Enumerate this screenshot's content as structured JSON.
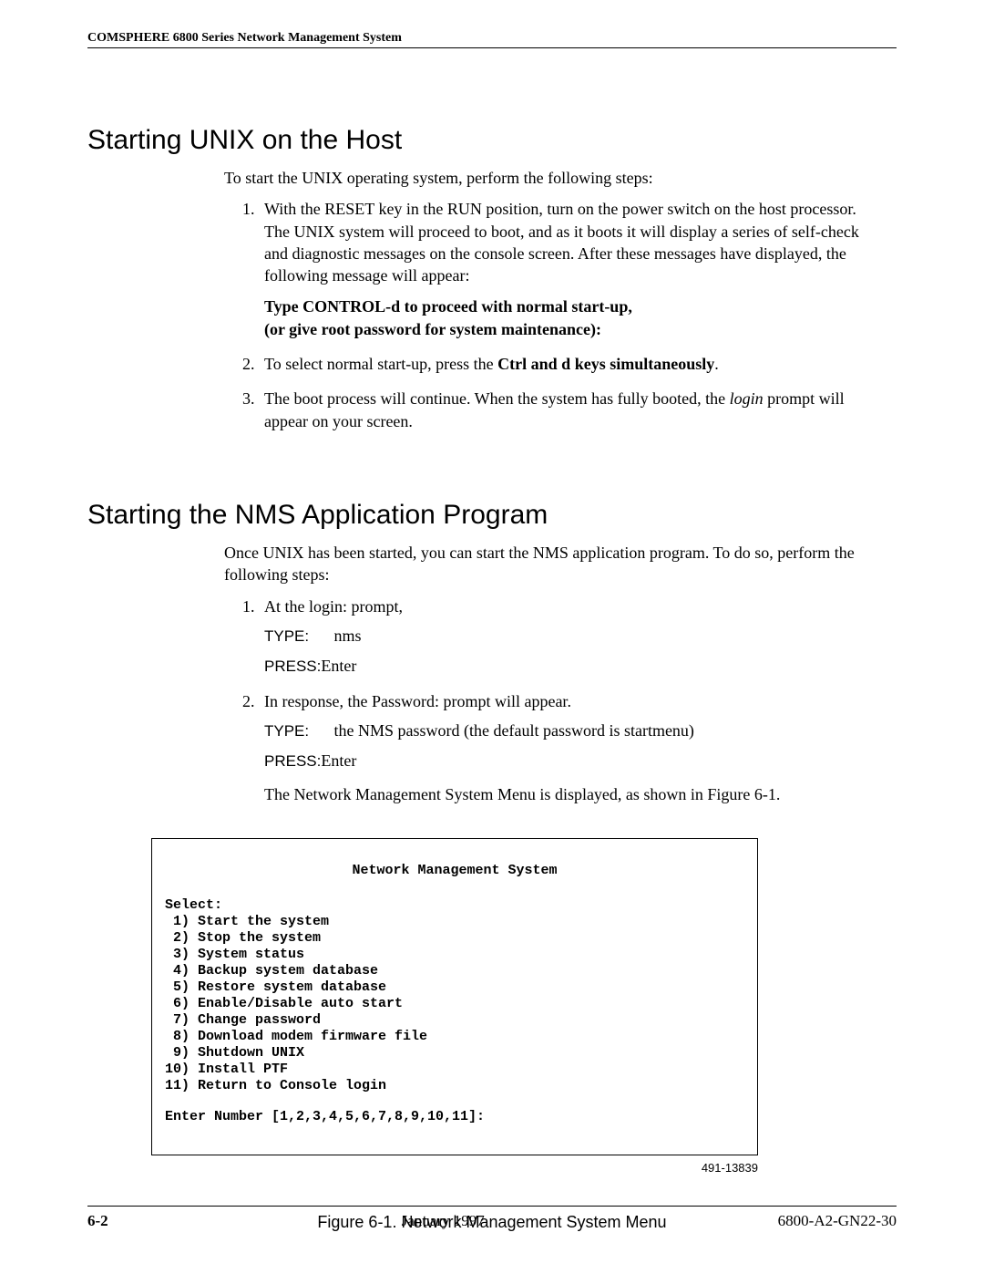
{
  "header": {
    "running_title": "COMSPHERE 6800 Series Network Management System"
  },
  "section1": {
    "heading": "Starting UNIX on the Host",
    "intro": "To start the UNIX operating system, perform the following steps:",
    "step1_text": "With the RESET key in the RUN position, turn on the power switch on the host processor. The UNIX system will proceed to boot, and as it boots it will display a series of self-check and diagnostic messages on the console screen. After these messages have displayed, the following message will appear:",
    "step1_msg_l1": "Type CONTROL-d to proceed with normal start-up,",
    "step1_msg_l2": "(or give root password for system maintenance):",
    "step2_pre": "To select normal start-up, press the ",
    "step2_bold": "Ctrl and d keys simultaneously",
    "step2_post": ".",
    "step3_pre": "The boot process will continue. When the system has fully booted, the ",
    "step3_ital": "login",
    "step3_post": " prompt will appear on your screen."
  },
  "section2": {
    "heading": "Starting the NMS Application Program",
    "intro": "Once UNIX has been started, you can start the NMS application program. To do so, perform the following steps:",
    "step1_text": "At the login: prompt,",
    "type_label": "TYPE:",
    "press_label": "PRESS:",
    "nms": "nms",
    "enter": "Enter",
    "step2_text": "In response, the Password: prompt will appear.",
    "step2_type_val": "the NMS password (the default password is startmenu)",
    "step2_result": "The Network Management System Menu is displayed, as shown in Figure 6-1."
  },
  "figure": {
    "title": "Network Management System",
    "select": "Select:",
    "items": [
      " 1) Start the system",
      " 2) Stop the system",
      " 3) System status",
      " 4) Backup system database",
      " 5) Restore system database",
      " 6) Enable/Disable auto start",
      " 7) Change password",
      " 8) Download modem firmware file",
      " 9) Shutdown UNIX",
      "10) Install PTF",
      "11) Return to Console login"
    ],
    "prompt": "Enter Number [1,2,3,4,5,6,7,8,9,10,11]:",
    "code": "491-13839",
    "caption": "Figure 6-1.  Network Management System Menu"
  },
  "footer": {
    "page": "6-2",
    "date": "January 1997",
    "doc": "6800-A2-GN22-30"
  }
}
